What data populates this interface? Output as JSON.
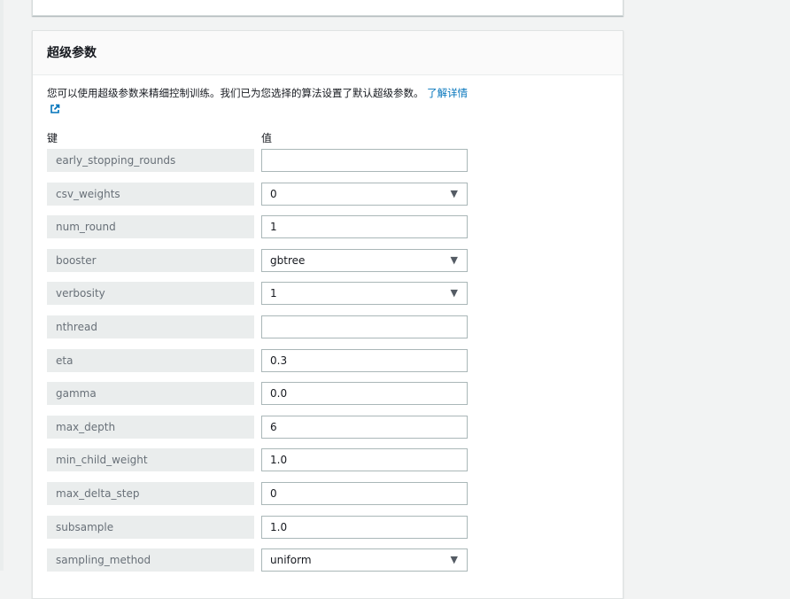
{
  "section": {
    "title": "超级参数",
    "description": "您可以使用超级参数来精细控制训练。我们已为您选择的算法设置了默认超级参数。",
    "learn_more": "了解详情",
    "key_header": "键",
    "value_header": "值"
  },
  "hyperparameters": [
    {
      "key": "early_stopping_rounds",
      "value": "",
      "type": "input"
    },
    {
      "key": "csv_weights",
      "value": "0",
      "type": "select"
    },
    {
      "key": "num_round",
      "value": "1",
      "type": "input"
    },
    {
      "key": "booster",
      "value": "gbtree",
      "type": "select"
    },
    {
      "key": "verbosity",
      "value": "1",
      "type": "select"
    },
    {
      "key": "nthread",
      "value": "",
      "type": "input"
    },
    {
      "key": "eta",
      "value": "0.3",
      "type": "input"
    },
    {
      "key": "gamma",
      "value": "0.0",
      "type": "input"
    },
    {
      "key": "max_depth",
      "value": "6",
      "type": "input"
    },
    {
      "key": "min_child_weight",
      "value": "1.0",
      "type": "input"
    },
    {
      "key": "max_delta_step",
      "value": "0",
      "type": "input"
    },
    {
      "key": "subsample",
      "value": "1.0",
      "type": "input"
    },
    {
      "key": "sampling_method",
      "value": "uniform",
      "type": "select"
    }
  ]
}
